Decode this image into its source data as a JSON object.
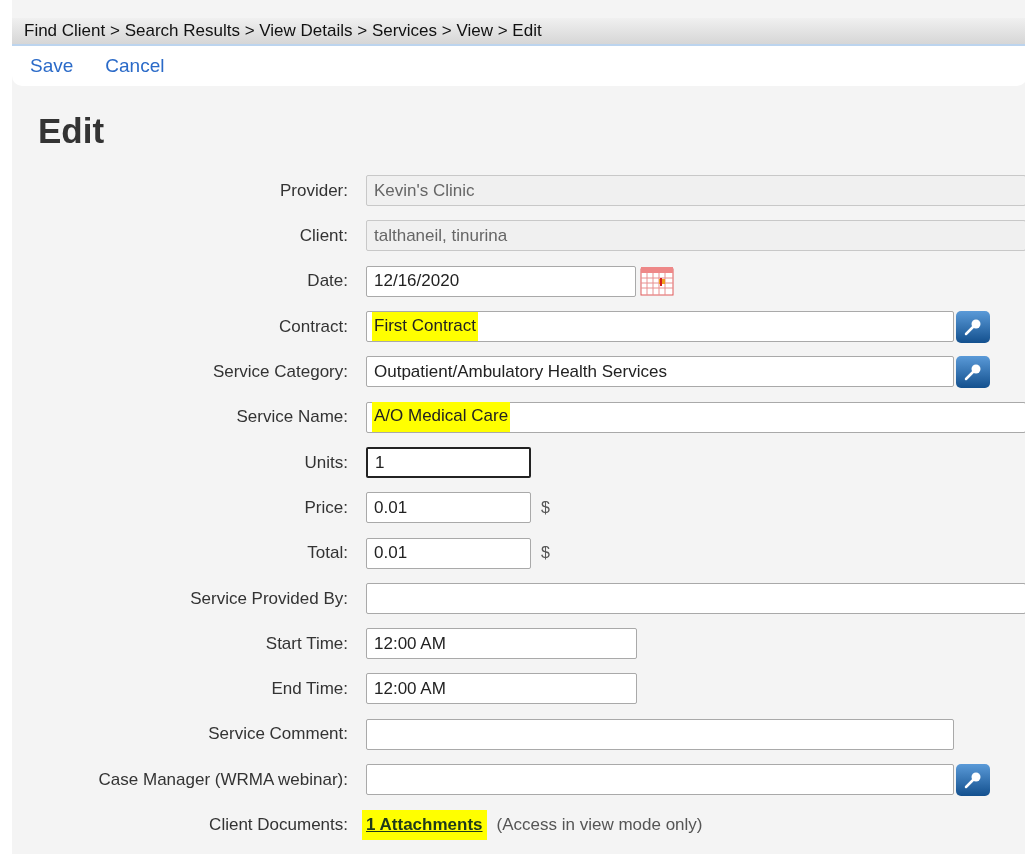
{
  "breadcrumb": [
    "Find Client",
    "Search Results",
    "View Details",
    "Services",
    "View",
    "Edit"
  ],
  "breadcrumb_separator": ">",
  "actions": [
    "Save",
    "Cancel"
  ],
  "heading": "Edit",
  "fields": [
    {
      "label": "Provider:",
      "kind": "readonly",
      "value": "Kevin's Clinic",
      "highlighted": false
    },
    {
      "label": "Client:",
      "kind": "readonly",
      "value": "talthaneil, tinurina",
      "highlighted": false
    },
    {
      "label": "Date:",
      "kind": "date",
      "value": "12/16/2020",
      "highlighted": false,
      "focused": false
    },
    {
      "label": "Contract:",
      "kind": "lookup",
      "value": "First Contract",
      "highlighted": true,
      "focused": false
    },
    {
      "label": "Service Category:",
      "kind": "lookup",
      "value": "Outpatient/Ambulatory Health Services",
      "highlighted": false,
      "focused": false
    },
    {
      "label": "Service Name:",
      "kind": "wide",
      "value": "A/O Medical Care",
      "highlighted": true,
      "focused": false
    },
    {
      "label": "Units:",
      "kind": "short",
      "value": "1",
      "highlighted": false,
      "focused": true
    },
    {
      "label": "Price:",
      "kind": "currency",
      "value": "0.01",
      "suffix": "$",
      "highlighted": false,
      "focused": false
    },
    {
      "label": "Total:",
      "kind": "currency",
      "value": "0.01",
      "suffix": "$",
      "highlighted": false,
      "focused": false
    },
    {
      "label": "Service Provided By:",
      "kind": "wide",
      "focused": false
    },
    {
      "label": "Start Time:",
      "kind": "medium",
      "value": "12:00 AM",
      "highlighted": false,
      "focused": false
    },
    {
      "label": "End Time:",
      "kind": "medium",
      "value": "12:00 AM",
      "highlighted": false,
      "focused": false
    },
    {
      "label": "Service Comment:",
      "kind": "comment",
      "focused": false
    },
    {
      "label": "Case Manager (WRMA webinar):",
      "kind": "lookup",
      "focused": false
    },
    {
      "label": "Client Documents:",
      "kind": "link",
      "value": "1 Attachments",
      "note": "(Access in view mode only)",
      "highlighted": true
    }
  ]
}
